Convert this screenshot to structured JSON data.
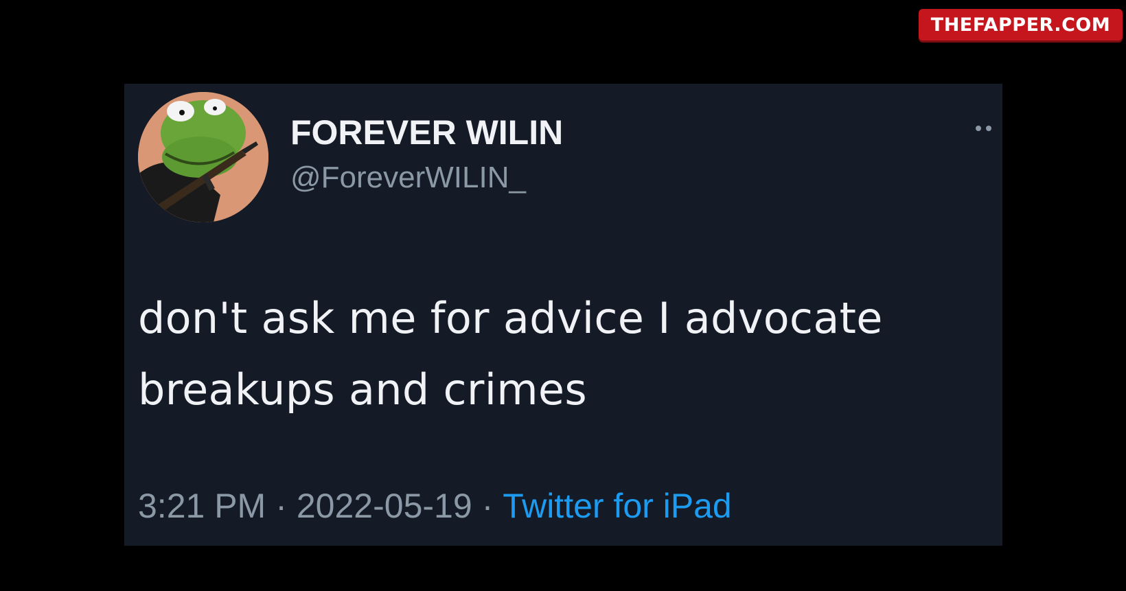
{
  "watermark": {
    "text": "THEFAPPER.COM"
  },
  "tweet": {
    "display_name": "FOREVER WILIN",
    "handle": "@ForeverWILIN_",
    "text": "don't ask me for advice I advocate breakups and crimes",
    "time": "3:21 PM",
    "date": "2022-05-19",
    "separator": "·",
    "source": "Twitter for iPad",
    "avatar_icon": "kermit-frog-with-rifle-avatar",
    "more_icon": "more-dots-icon"
  },
  "colors": {
    "page_background": "#000000",
    "card_background": "#151b26",
    "primary_text": "#f0f2f5",
    "secondary_text": "#8b98a5",
    "link": "#1d9bf0",
    "watermark_background": "#c4161c"
  }
}
